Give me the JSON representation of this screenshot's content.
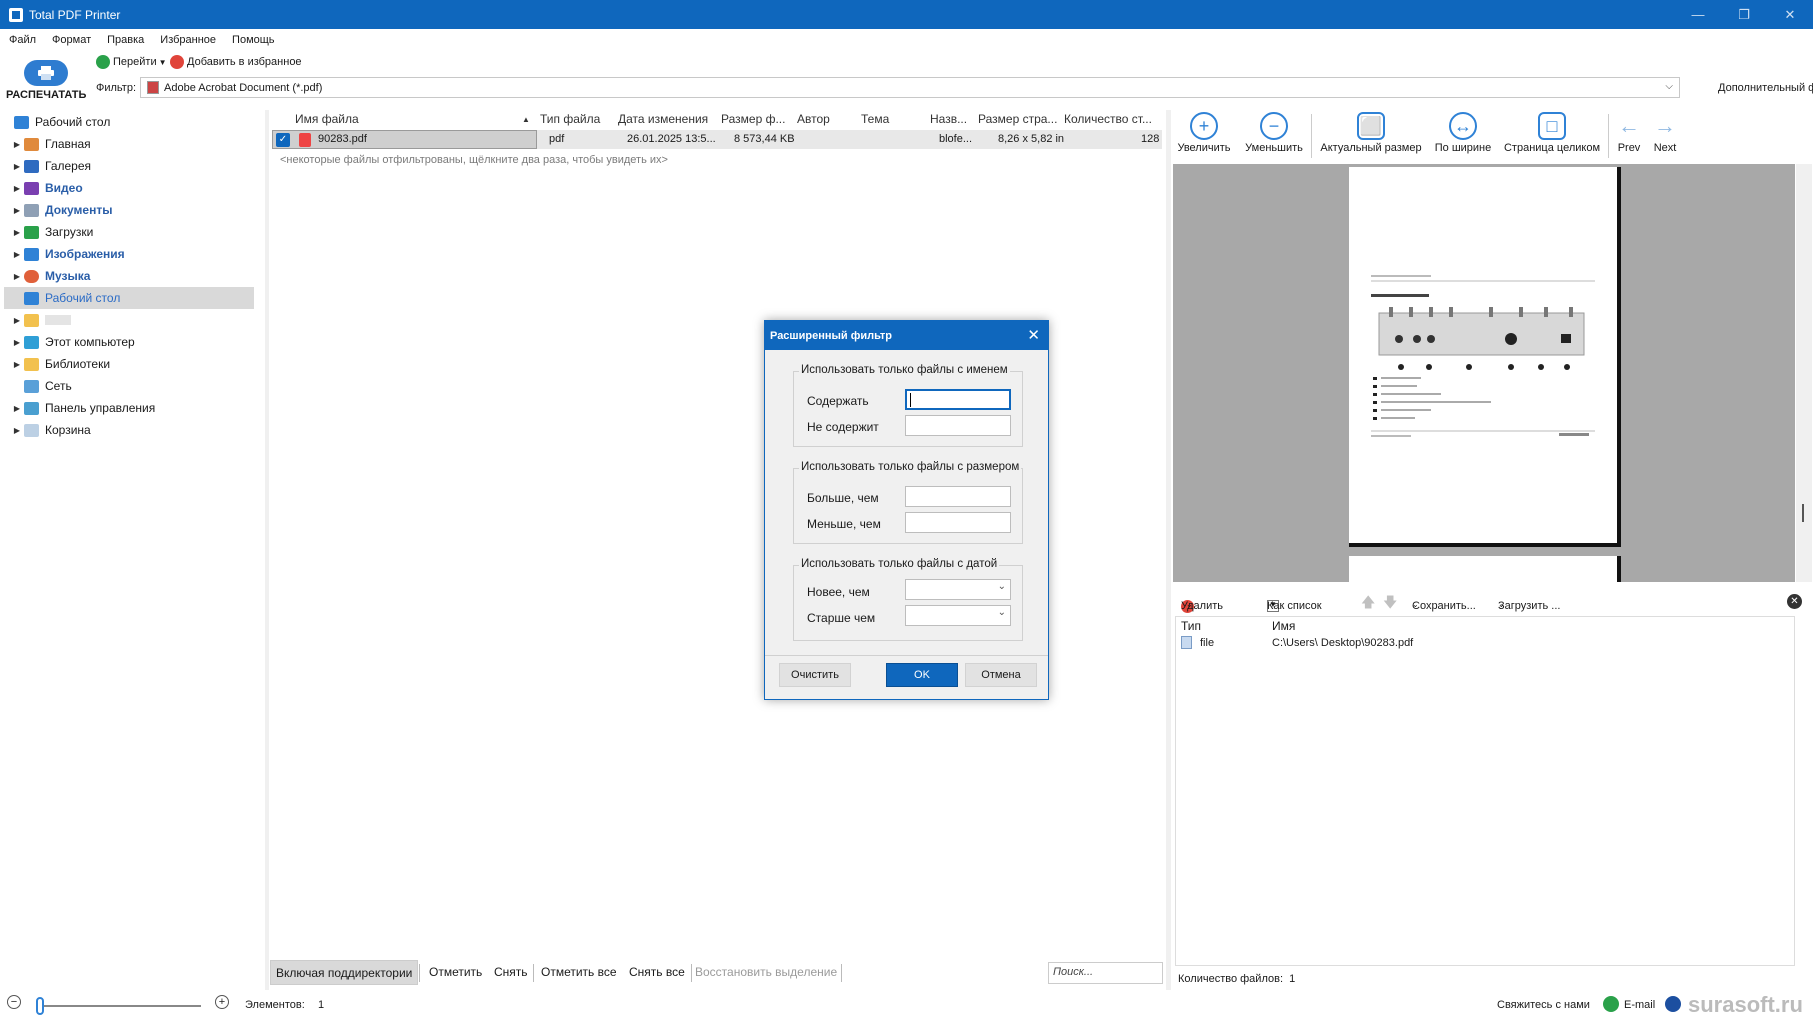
{
  "window": {
    "title": "Total PDF Printer"
  },
  "menu": [
    "Файл",
    "Формат",
    "Правка",
    "Избранное",
    "Помощь"
  ],
  "toolbar": {
    "print_label": "РАСПЕЧАТАТЬ",
    "goto_label": "Перейти",
    "favorite_label": "Добавить в избранное",
    "filter_label": "Фильтр:",
    "filter_value": "Adobe Acrobat Document (*.pdf)",
    "extra_filter_label": "Дополнительный ф"
  },
  "tree": {
    "root": "Рабочий стол",
    "items": [
      "Главная",
      "Галерея",
      "Видео",
      "Документы",
      "Загрузки",
      "Изображения",
      "Музыка",
      "Рабочий стол",
      "",
      "Этот компьютер",
      "Библиотеки",
      "Сеть",
      "Панель управления",
      "Корзина"
    ]
  },
  "filelist": {
    "columns": [
      "Имя файла",
      "Тип файла",
      "Дата изменения",
      "Размер ф...",
      "Автор",
      "Тема",
      "Назв...",
      "Размер стра...",
      "Количество ст..."
    ],
    "rows": [
      {
        "name": "90283.pdf",
        "type": "pdf",
        "date": "26.01.2025 13:5...",
        "size": "8 573,44 KB",
        "author": "",
        "subject": "",
        "title": "blofe...",
        "page_size": "8,26 x 5,82 in",
        "pages": "128"
      }
    ],
    "note": "<некоторые файлы отфильтрованы, щёлкните два раза, чтобы увидеть их>"
  },
  "bottom_bar": {
    "subdirs": "Включая поддиректории",
    "mark": "Отметить",
    "unmark": "Снять",
    "mark_all": "Отметить все",
    "unmark_all": "Снять все",
    "restore": "Восстановить выделение",
    "search_placeholder": "Поиск..."
  },
  "viewer": {
    "zoom_in": "Увеличить",
    "zoom_out": "Уменьшить",
    "actual_size": "Актуальный размер",
    "fit_width": "По ширине",
    "fit_page": "Страница целиком",
    "prev": "Prev",
    "next": "Next"
  },
  "lower_panel": {
    "delete": "Удалить",
    "as_list": "Как список",
    "save": "Сохранить...",
    "load": "Загрузить ...",
    "col_type": "Тип",
    "col_name": "Имя",
    "row_type": "file",
    "row_path": "C:\\Users\\      Desktop\\90283.pdf",
    "count_label": "Количество файлов:",
    "count_value": "1"
  },
  "status": {
    "elements_label": "Элементов:",
    "elements_value": "1",
    "contact": "Свяжитесь с нами",
    "email": "E-mail",
    "watermark": "surasoft.ru"
  },
  "dialog": {
    "title": "Расширенный фильтр",
    "group_name": "Использовать только файлы с именем",
    "contains": "Содержать",
    "not_contains": "Не содержит",
    "group_size": "Использовать только файлы с размером",
    "greater": "Больше, чем",
    "less": "Меньше, чем",
    "group_date": "Использовать только файлы с датой",
    "newer": "Новее, чем",
    "older": "Старше чем",
    "clear": "Очистить",
    "ok": "OK",
    "cancel": "Отмена"
  },
  "colors": {
    "accent": "#0f67bd",
    "icon_blue": "#2f82d6"
  }
}
